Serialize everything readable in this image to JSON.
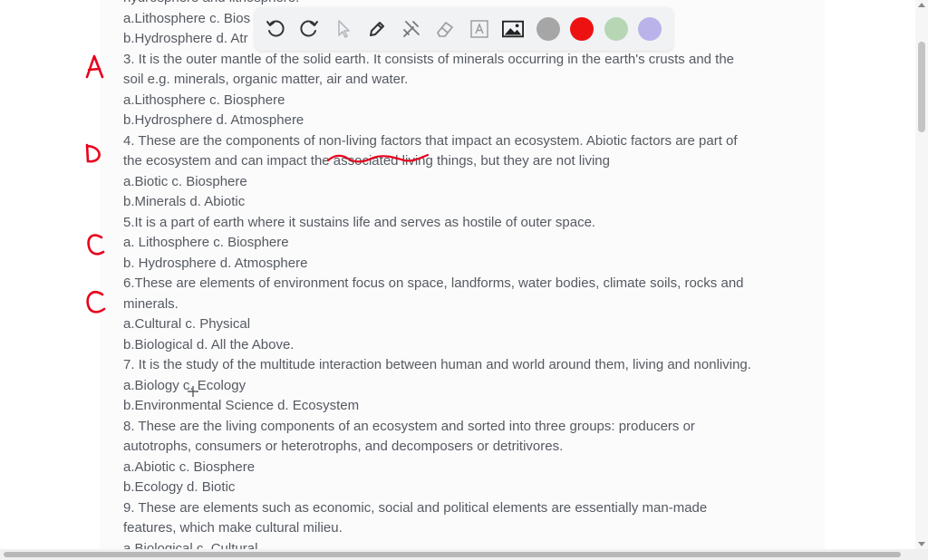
{
  "document": {
    "lines": [
      "hydrosphere and lithosphere.",
      "a.Lithosphere c. Bios",
      "b.Hydrosphere d. Atr",
      "3. It is the outer mantle of the solid earth. It consists of minerals occurring in the earth's crusts and the",
      "soil e.g. minerals, organic matter, air and water.",
      "a.Lithosphere c. Biosphere",
      "b.Hydrosphere d. Atmosphere",
      "4. These are the components of non-living factors that impact an ecosystem. Abiotic factors are part of",
      "the ecosystem and can impact the associated living things, but they are not living",
      "a.Biotic c. Biosphere",
      "b.Minerals d. Abiotic",
      "5.It is a part of earth where it sustains life and serves as hostile of outer space.",
      "a. Lithosphere c. Biosphere",
      "b. Hydrosphere d. Atmosphere",
      "6.These are elements of environment focus on space, landforms, water bodies, climate soils, rocks and",
      "minerals.",
      "a.Cultural c. Physical",
      "b.Biological d. All the Above.",
      "7. It is the study of the multitude interaction between human and world around them, living and nonliving.",
      "a.Biology c. Ecology",
      "b.Environmental Science d. Ecosystem",
      "8. These are the living components of an ecosystem and sorted into three groups: producers or",
      "autotrophs, consumers or heterotrophs, and decomposers or detritivores.",
      "a.Abiotic c. Biosphere",
      "b.Ecology d. Biotic",
      "9. These are elements such as economic, social and political elements are essentially man-made",
      "features, which make cultural milieu.",
      "a.Biological c. Cultural"
    ]
  },
  "handwritten_answers": [
    "A",
    "D",
    "C",
    "C"
  ],
  "toolbar": {
    "tools": [
      "undo-icon",
      "redo-icon",
      "pointer-icon",
      "pen-icon",
      "tools-icon",
      "eraser-icon",
      "text-box-icon",
      "image-icon"
    ],
    "colors": [
      "#a6a6a6",
      "#ee1111",
      "#b7d6b4",
      "#b9b3ea"
    ]
  },
  "colors": {
    "ink": "#e8001c",
    "text": "#555a60",
    "page_bg": "#fbfbfc"
  }
}
